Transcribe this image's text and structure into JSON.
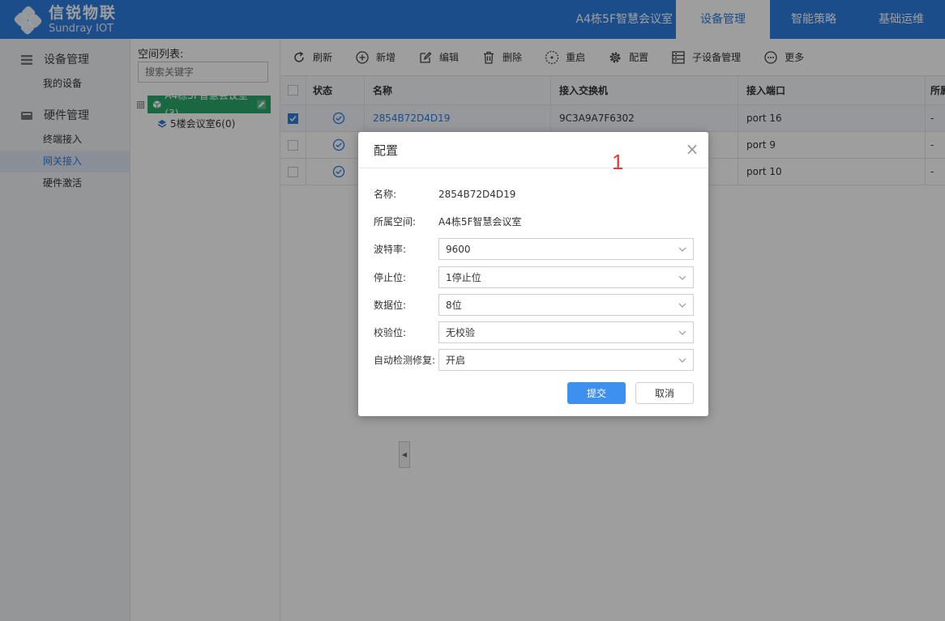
{
  "brand": {
    "name_cn": "信锐物联",
    "name_en": "Sundray IOT"
  },
  "nav": {
    "site": "A4栋5F智慧会议室",
    "items": [
      "设备管理",
      "智能策略",
      "基础运维"
    ],
    "active": "设备管理"
  },
  "sidebar": {
    "group1": "设备管理",
    "group1_items": [
      "我的设备"
    ],
    "group2": "硬件管理",
    "group2_items": [
      "终端接入",
      "网关接入",
      "硬件激活"
    ],
    "active": "网关接入"
  },
  "tree": {
    "title": "空间列表:",
    "search_placeholder": "搜索关键字",
    "toggle": "⊟",
    "root": "A4栋5F智慧会议室(3)",
    "child": "5楼会议室6(0)"
  },
  "toolbar": {
    "refresh": "刷新",
    "add": "新增",
    "edit": "编辑",
    "delete": "删除",
    "reboot": "重启",
    "config": "配置",
    "sub_device": "子设备管理",
    "more": "更多"
  },
  "table": {
    "headers": {
      "status": "状态",
      "name": "名称",
      "switch": "接入交换机",
      "port": "接入端口",
      "extra": "所属"
    },
    "rows": [
      {
        "name": "2854B72D4D19",
        "switch": "9C3A9A7F6302",
        "port": "port 16",
        "extra": "-",
        "checked": true
      },
      {
        "name": "",
        "switch": "",
        "port": "port 9",
        "extra": "-",
        "checked": false
      },
      {
        "name": "",
        "switch": "",
        "port": "port 10",
        "extra": "-",
        "checked": false
      }
    ]
  },
  "dialog": {
    "title": "配置",
    "annotation": "1",
    "close": "×",
    "name_label": "名称:",
    "name_value": "2854B72D4D19",
    "space_label": "所属空间:",
    "space_value": "A4栋5F智慧会议室",
    "baud_label": "波特率:",
    "baud_value": "9600",
    "stop_label": "停止位:",
    "stop_value": "1停止位",
    "data_label": "数据位:",
    "data_value": "8位",
    "parity_label": "校验位:",
    "parity_value": "无校验",
    "auto_label": "自动检测修复:",
    "auto_value": "开启",
    "submit": "提交",
    "cancel": "取消"
  },
  "colors": {
    "primary": "#2d7ce0",
    "tree_active": "#2aa86b",
    "submit": "#3d8ff0",
    "annotation": "#e53935"
  }
}
